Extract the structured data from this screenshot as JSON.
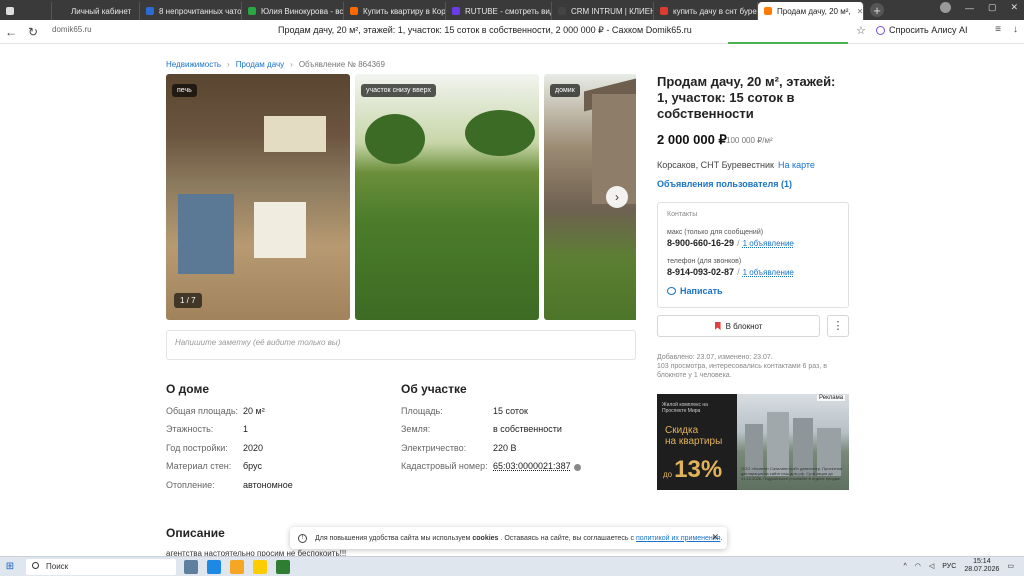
{
  "browser": {
    "tabs": [
      {
        "label": "Личный кабинет",
        "color": "#3a3a3a"
      },
      {
        "label": "8 непрочитанных чатов",
        "color": "#2a6cd6"
      },
      {
        "label": "Юлия Винокурова - все",
        "color": "#27a844"
      },
      {
        "label": "Купить квартиру в Корс",
        "color": "#ff6a00"
      },
      {
        "label": "RUTUBE - смотреть видео",
        "color": "#6a3de8"
      },
      {
        "label": "CRM INTRUM | КЛИЕНТ",
        "color": "#444444"
      },
      {
        "label": "купить дачу в снт буреве",
        "color": "#e03b2f"
      },
      {
        "label": "Продам дачу, 20 м²,",
        "color": "#ff7a00"
      }
    ],
    "domain": "domik65.ru",
    "page_title": "Продам дачу, 20 м², этажей: 1, участок: 15 соток в собственности, 2 000 000 ₽ - Сахком Domik65.ru",
    "alisa_label": "Спросить Алису AI"
  },
  "breadcrumb": {
    "items": [
      "Недвижимость",
      "Продам дачу"
    ],
    "current": "Объявление № 864369"
  },
  "gallery": {
    "tags": [
      "печь",
      "участок снизу вверх",
      "домик"
    ],
    "counter": "1 / 7"
  },
  "note_placeholder": "Напишите заметку (её видите только вы)",
  "about_house": {
    "title": "О доме",
    "rows": [
      {
        "k": "Общая площадь:",
        "v": "20 м²"
      },
      {
        "k": "Этажность:",
        "v": "1"
      },
      {
        "k": "Год постройки:",
        "v": "2020"
      },
      {
        "k": "Материал стен:",
        "v": "брус"
      },
      {
        "k": "Отопление:",
        "v": "автономное"
      }
    ]
  },
  "about_plot": {
    "title": "Об участке",
    "rows": [
      {
        "k": "Площадь:",
        "v": "15 соток"
      },
      {
        "k": "Земля:",
        "v": "в собственности"
      },
      {
        "k": "Электричество:",
        "v": "220 В"
      },
      {
        "k": "Кадастровый номер:",
        "v": "65:03:0000021:387"
      }
    ]
  },
  "description": {
    "title": "Описание",
    "text": "агентства настоятельно просим не беспокоить!!!"
  },
  "listing": {
    "title": "Продам дачу, 20 м², этажей: 1, участок: 15 соток в собственности",
    "price": "2 000 000 ₽",
    "price_per_m": "100 000 ₽/м²",
    "location": "Корсаков, СНТ Буревестник",
    "map_link": "На карте",
    "user_ads": "Объявления пользователя (1)"
  },
  "contacts": {
    "header": "Контакты",
    "entries": [
      {
        "name": "макс (только для сообщений)",
        "phone": "8-900-660-16-29",
        "sep": "/",
        "ads": "1 объявление"
      },
      {
        "name": "телефон (для звонков)",
        "phone": "8-914-093-02-87",
        "sep": "/",
        "ads": "1 объявление"
      }
    ],
    "write_label": "Написать"
  },
  "actions": {
    "notebook_label": "В блокнот",
    "more_label": "⋮"
  },
  "meta": {
    "line1": "Добавлено: 23.07, изменено: 23.07.",
    "line2": "103 просмотра, интересовались контактами 6 раз, в блокноте у 1 человека."
  },
  "ad": {
    "label": "Реклама",
    "small_text": "Жилой комплекс на Проспекте Мира",
    "skidka_line1": "Скидка",
    "skidka_line2": "на квартиры",
    "pct_prefix": "до",
    "pct_value": "13%",
    "legal": "ООО «Комитет Сахалинстрой» девелопер. Проектная декларация на сайте наш.дом.рф. Срок акции до 31.12.2026. Подробности уточняйте в отделе продаж."
  },
  "cookie": {
    "text_before": "Для повышения удобства сайта мы используем",
    "bold": "cookies",
    "text_after": ". Оставаясь на сайте, вы соглашаетесь с",
    "link": "политикой их применения",
    "close": "✕"
  },
  "taskbar": {
    "search_label": "Поиск",
    "lang": "РУС",
    "time": "15:14",
    "date": "28.07.2026",
    "icons": [
      "#5f7f9f",
      "#1e88e5",
      "#f5a623",
      "#ffcc00",
      "#2e7d32"
    ]
  }
}
